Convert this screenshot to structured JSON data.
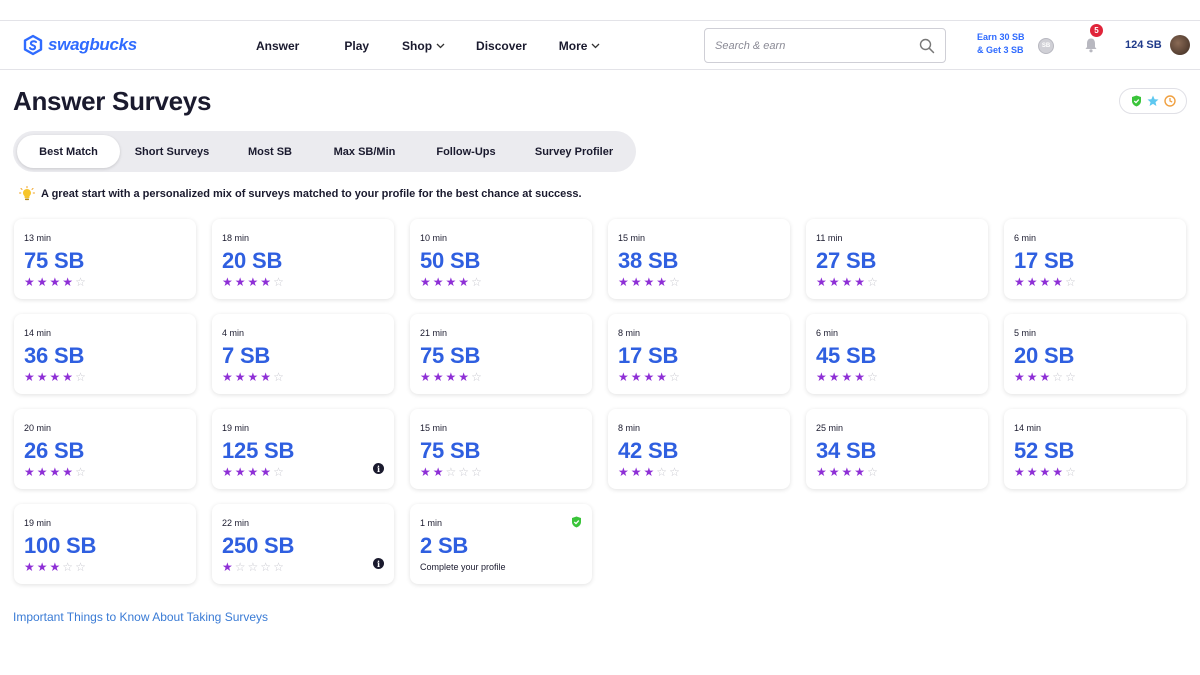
{
  "header": {
    "logo_text": "swagbucks",
    "nav": [
      {
        "label": "Answer",
        "has_dropdown": false
      },
      {
        "label": "Play",
        "has_dropdown": false
      },
      {
        "label": "Shop",
        "has_dropdown": true
      },
      {
        "label": "Discover",
        "has_dropdown": false
      },
      {
        "label": "More",
        "has_dropdown": true
      }
    ],
    "search_placeholder": "Search & earn",
    "earn_line1": "Earn 30 SB",
    "earn_line2": "& Get 3 SB",
    "notification_count": "5",
    "balance": "124 SB"
  },
  "page": {
    "title": "Answer Surveys",
    "tabs": [
      {
        "label": "Best Match",
        "active": true
      },
      {
        "label": "Short Surveys",
        "active": false
      },
      {
        "label": "Most SB",
        "active": false
      },
      {
        "label": "Max SB/Min",
        "active": false
      },
      {
        "label": "Follow-Ups",
        "active": false
      },
      {
        "label": "Survey Profiler",
        "active": false
      }
    ],
    "tip": "A great start with a personalized mix of surveys matched to your profile for the best chance at success.",
    "footer_link": "Important Things to Know About Taking Surveys"
  },
  "surveys": [
    {
      "time": "13 min",
      "reward": "75 SB",
      "rating": 4
    },
    {
      "time": "18 min",
      "reward": "20 SB",
      "rating": 4
    },
    {
      "time": "10 min",
      "reward": "50 SB",
      "rating": 4
    },
    {
      "time": "15 min",
      "reward": "38 SB",
      "rating": 4
    },
    {
      "time": "11 min",
      "reward": "27 SB",
      "rating": 4
    },
    {
      "time": "6 min",
      "reward": "17 SB",
      "rating": 4
    },
    {
      "time": "14 min",
      "reward": "36 SB",
      "rating": 4
    },
    {
      "time": "4 min",
      "reward": "7 SB",
      "rating": 4
    },
    {
      "time": "21 min",
      "reward": "75 SB",
      "rating": 4
    },
    {
      "time": "8 min",
      "reward": "17 SB",
      "rating": 4
    },
    {
      "time": "6 min",
      "reward": "45 SB",
      "rating": 4
    },
    {
      "time": "5 min",
      "reward": "20 SB",
      "rating": 3
    },
    {
      "time": "20 min",
      "reward": "26 SB",
      "rating": 4
    },
    {
      "time": "19 min",
      "reward": "125 SB",
      "rating": 4,
      "info": true
    },
    {
      "time": "15 min",
      "reward": "75 SB",
      "rating": 2
    },
    {
      "time": "8 min",
      "reward": "42 SB",
      "rating": 3
    },
    {
      "time": "25 min",
      "reward": "34 SB",
      "rating": 4
    },
    {
      "time": "14 min",
      "reward": "52 SB",
      "rating": 4
    },
    {
      "time": "19 min",
      "reward": "100 SB",
      "rating": 3
    },
    {
      "time": "22 min",
      "reward": "250 SB",
      "rating": 1,
      "info": true
    },
    {
      "time": "1 min",
      "reward": "2 SB",
      "subtitle": "Complete your profile",
      "verified": true
    }
  ],
  "colors": {
    "brand": "#2f6bff",
    "reward": "#2f5fe0",
    "star": "#8e2fd6",
    "link": "#3a7bd5",
    "notification": "#e0243a"
  }
}
